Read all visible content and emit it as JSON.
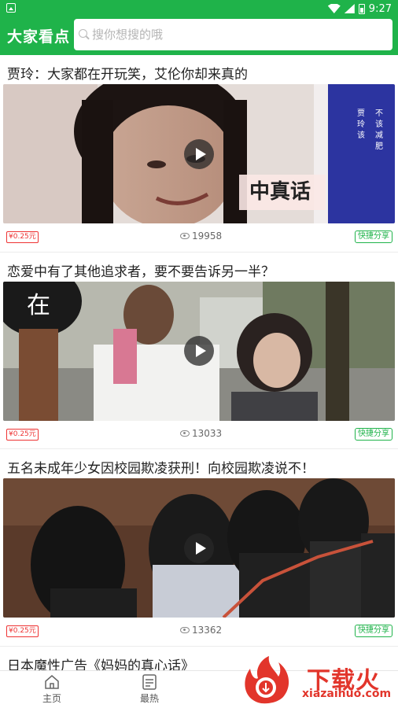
{
  "status": {
    "time": "9:27"
  },
  "header": {
    "title": "大家看点",
    "search_placeholder": "搜你想搜的哦"
  },
  "feed": [
    {
      "title": "贾玲：大家都在开玩笑，艾伦你却来真的",
      "price": "¥0.25元",
      "views": "19958",
      "share": "快捷分享",
      "video_text": "贾玲该不该减肥"
    },
    {
      "title": "恋爱中有了其他追求者，要不要告诉另一半？",
      "price": "¥0.25元",
      "views": "13033",
      "share": "快捷分享"
    },
    {
      "title": "五名未成年少女因校园欺凌获刑！向校园欺凌说不！",
      "price": "¥0.25元",
      "views": "13362",
      "share": "快捷分享"
    },
    {
      "title": "日本魔性广告《妈妈的真心话》"
    }
  ],
  "nav": {
    "home": "主页",
    "hot": "最热"
  },
  "watermark": {
    "brand": "下载火",
    "url": "xiazaihuo.com"
  },
  "colors": {
    "primary": "#1fb34a",
    "price": "#e33333"
  }
}
